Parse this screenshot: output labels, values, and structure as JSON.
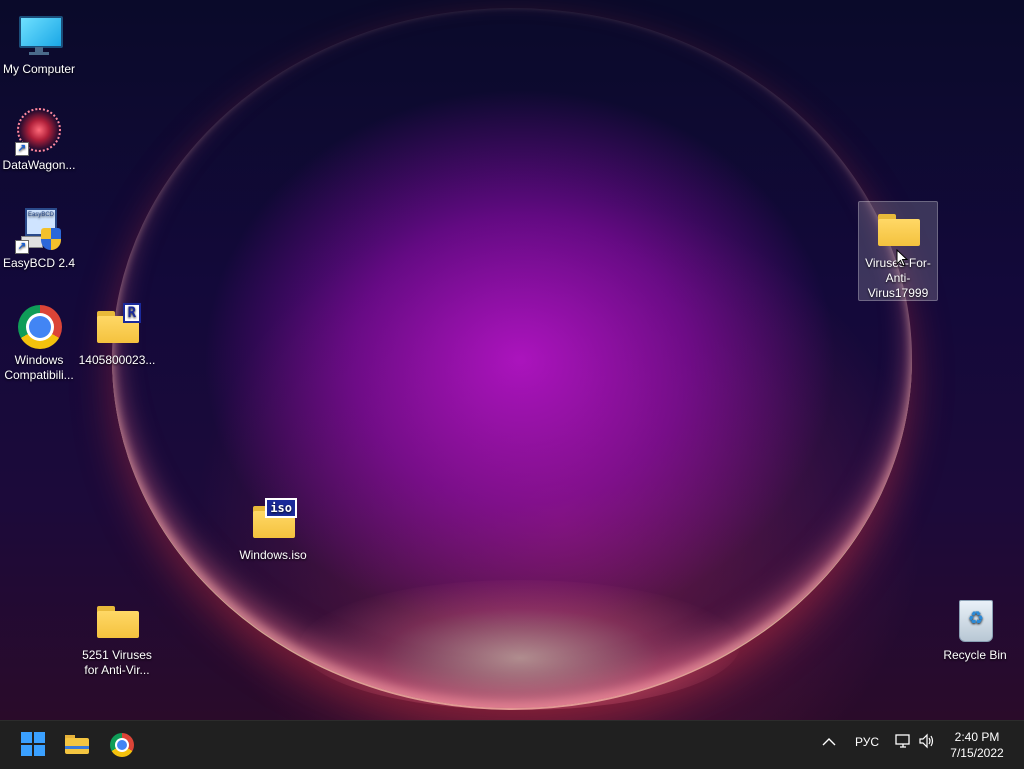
{
  "desktop": {
    "icons": {
      "my_computer": {
        "label": "My Computer",
        "icon": "monitor-icon"
      },
      "datawagon": {
        "label": "DataWagon...",
        "icon": "datawagon-shortcut-icon"
      },
      "easybcd": {
        "label": "EasyBCD 2.4",
        "icon": "easybcd-icon"
      },
      "windows_compat": {
        "label": "Windows Compatibili...",
        "icon": "chrome-icon"
      },
      "rar_folder": {
        "label": "1405800023...",
        "badge": "R",
        "icon": "archive-folder-icon"
      },
      "viruses_folder": {
        "label": "Viruses-For-Anti-Virus17999",
        "icon": "folder-icon",
        "selected": true
      },
      "windows_iso": {
        "label": "Windows.iso",
        "badge": "iso",
        "icon": "iso-file-icon"
      },
      "viruses_5251": {
        "label": "5251 Viruses for Anti-Vir...",
        "icon": "folder-icon"
      },
      "recycle_bin": {
        "label": "Recycle Bin",
        "icon": "recycle-bin-icon"
      }
    }
  },
  "taskbar": {
    "apps": [
      {
        "name": "Start",
        "icon": "windows-logo-icon"
      },
      {
        "name": "File Explorer",
        "icon": "file-explorer-icon"
      },
      {
        "name": "Google Chrome",
        "icon": "chrome-icon"
      }
    ],
    "tray": {
      "chevron": "^",
      "language": "РУС",
      "network_icon": "network-icon",
      "volume_icon": "volume-icon",
      "time": "2:40 PM",
      "date": "7/15/2022"
    }
  },
  "colors": {
    "taskbar_bg": "#202020",
    "accent": "#3aa0ff"
  }
}
